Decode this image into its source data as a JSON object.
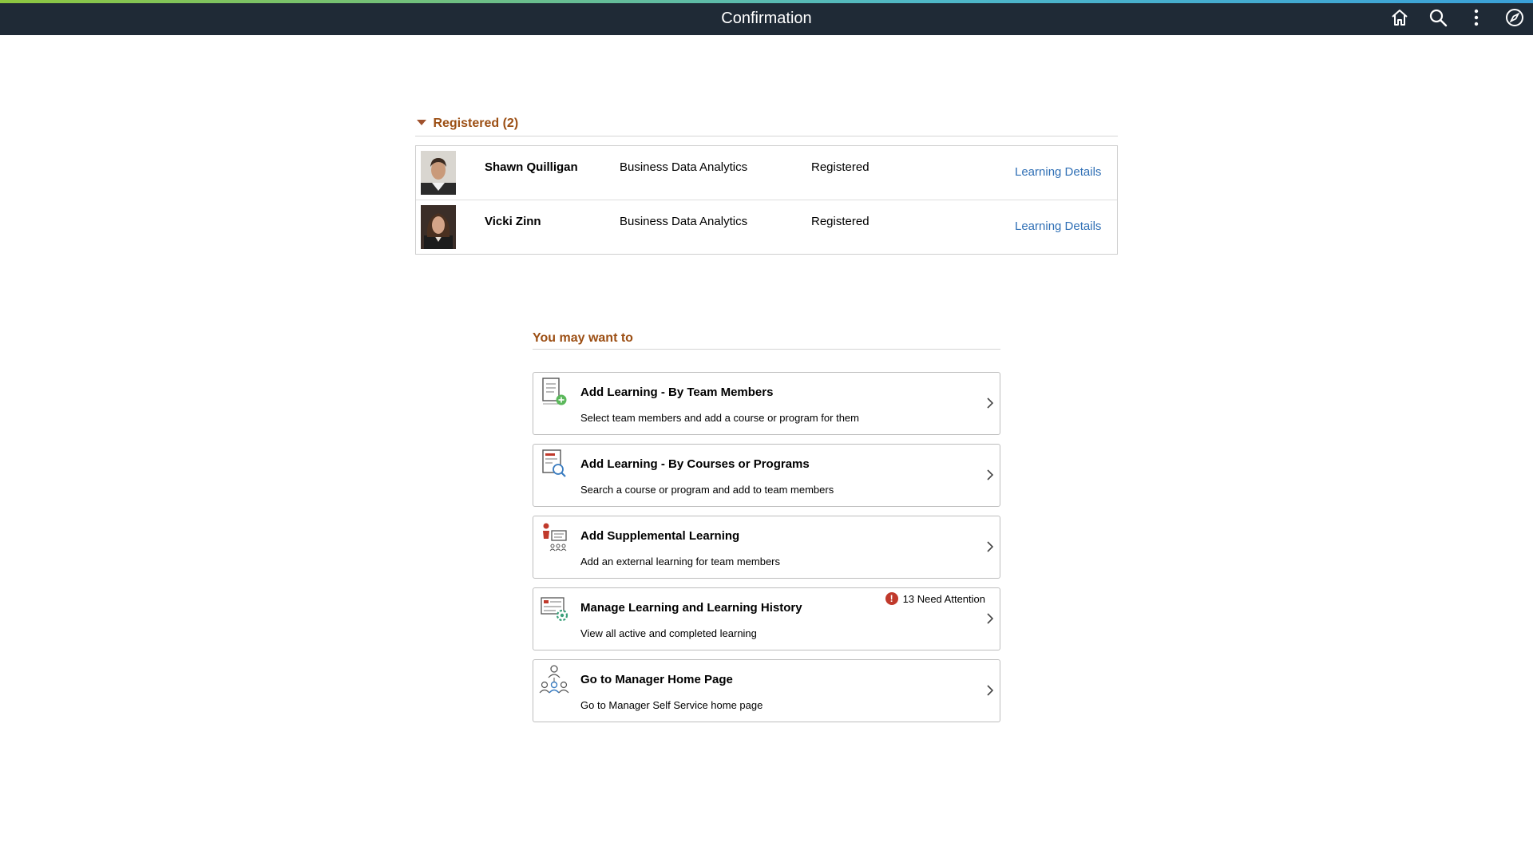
{
  "header": {
    "title": "Confirmation",
    "icons": [
      "home-icon",
      "search-icon",
      "more-options-icon",
      "navbar-compass-icon"
    ]
  },
  "registered": {
    "heading": "Registered (2)",
    "rows": [
      {
        "name": "Shawn Quilligan",
        "course": "Business Data Analytics",
        "status": "Registered",
        "link": "Learning Details"
      },
      {
        "name": "Vicki Zinn",
        "course": "Business Data Analytics",
        "status": "Registered",
        "link": "Learning Details"
      }
    ]
  },
  "you_may_want_to": {
    "heading": "You may want to",
    "tiles": [
      {
        "title": "Add Learning - By Team Members",
        "desc": "Select team members and add a course or program for them",
        "icon": "add-learning-document-icon"
      },
      {
        "title": "Add Learning - By Courses or Programs",
        "desc": "Search a course or program and add to team members",
        "icon": "search-course-document-icon"
      },
      {
        "title": "Add Supplemental Learning",
        "desc": "Add an external learning for team members",
        "icon": "supplemental-learning-icon"
      },
      {
        "title": "Manage Learning and Learning History",
        "desc": "View all active and completed learning",
        "icon": "manage-learning-gear-icon",
        "badge": "13 Need Attention"
      },
      {
        "title": "Go to Manager Home Page",
        "desc": "Go to Manager Self Service home page",
        "icon": "team-people-icon"
      }
    ]
  },
  "colors": {
    "header_bg": "#1f2a36",
    "section_heading": "#9c4f14",
    "link": "#2f6fb5",
    "alert": "#c0392b"
  }
}
